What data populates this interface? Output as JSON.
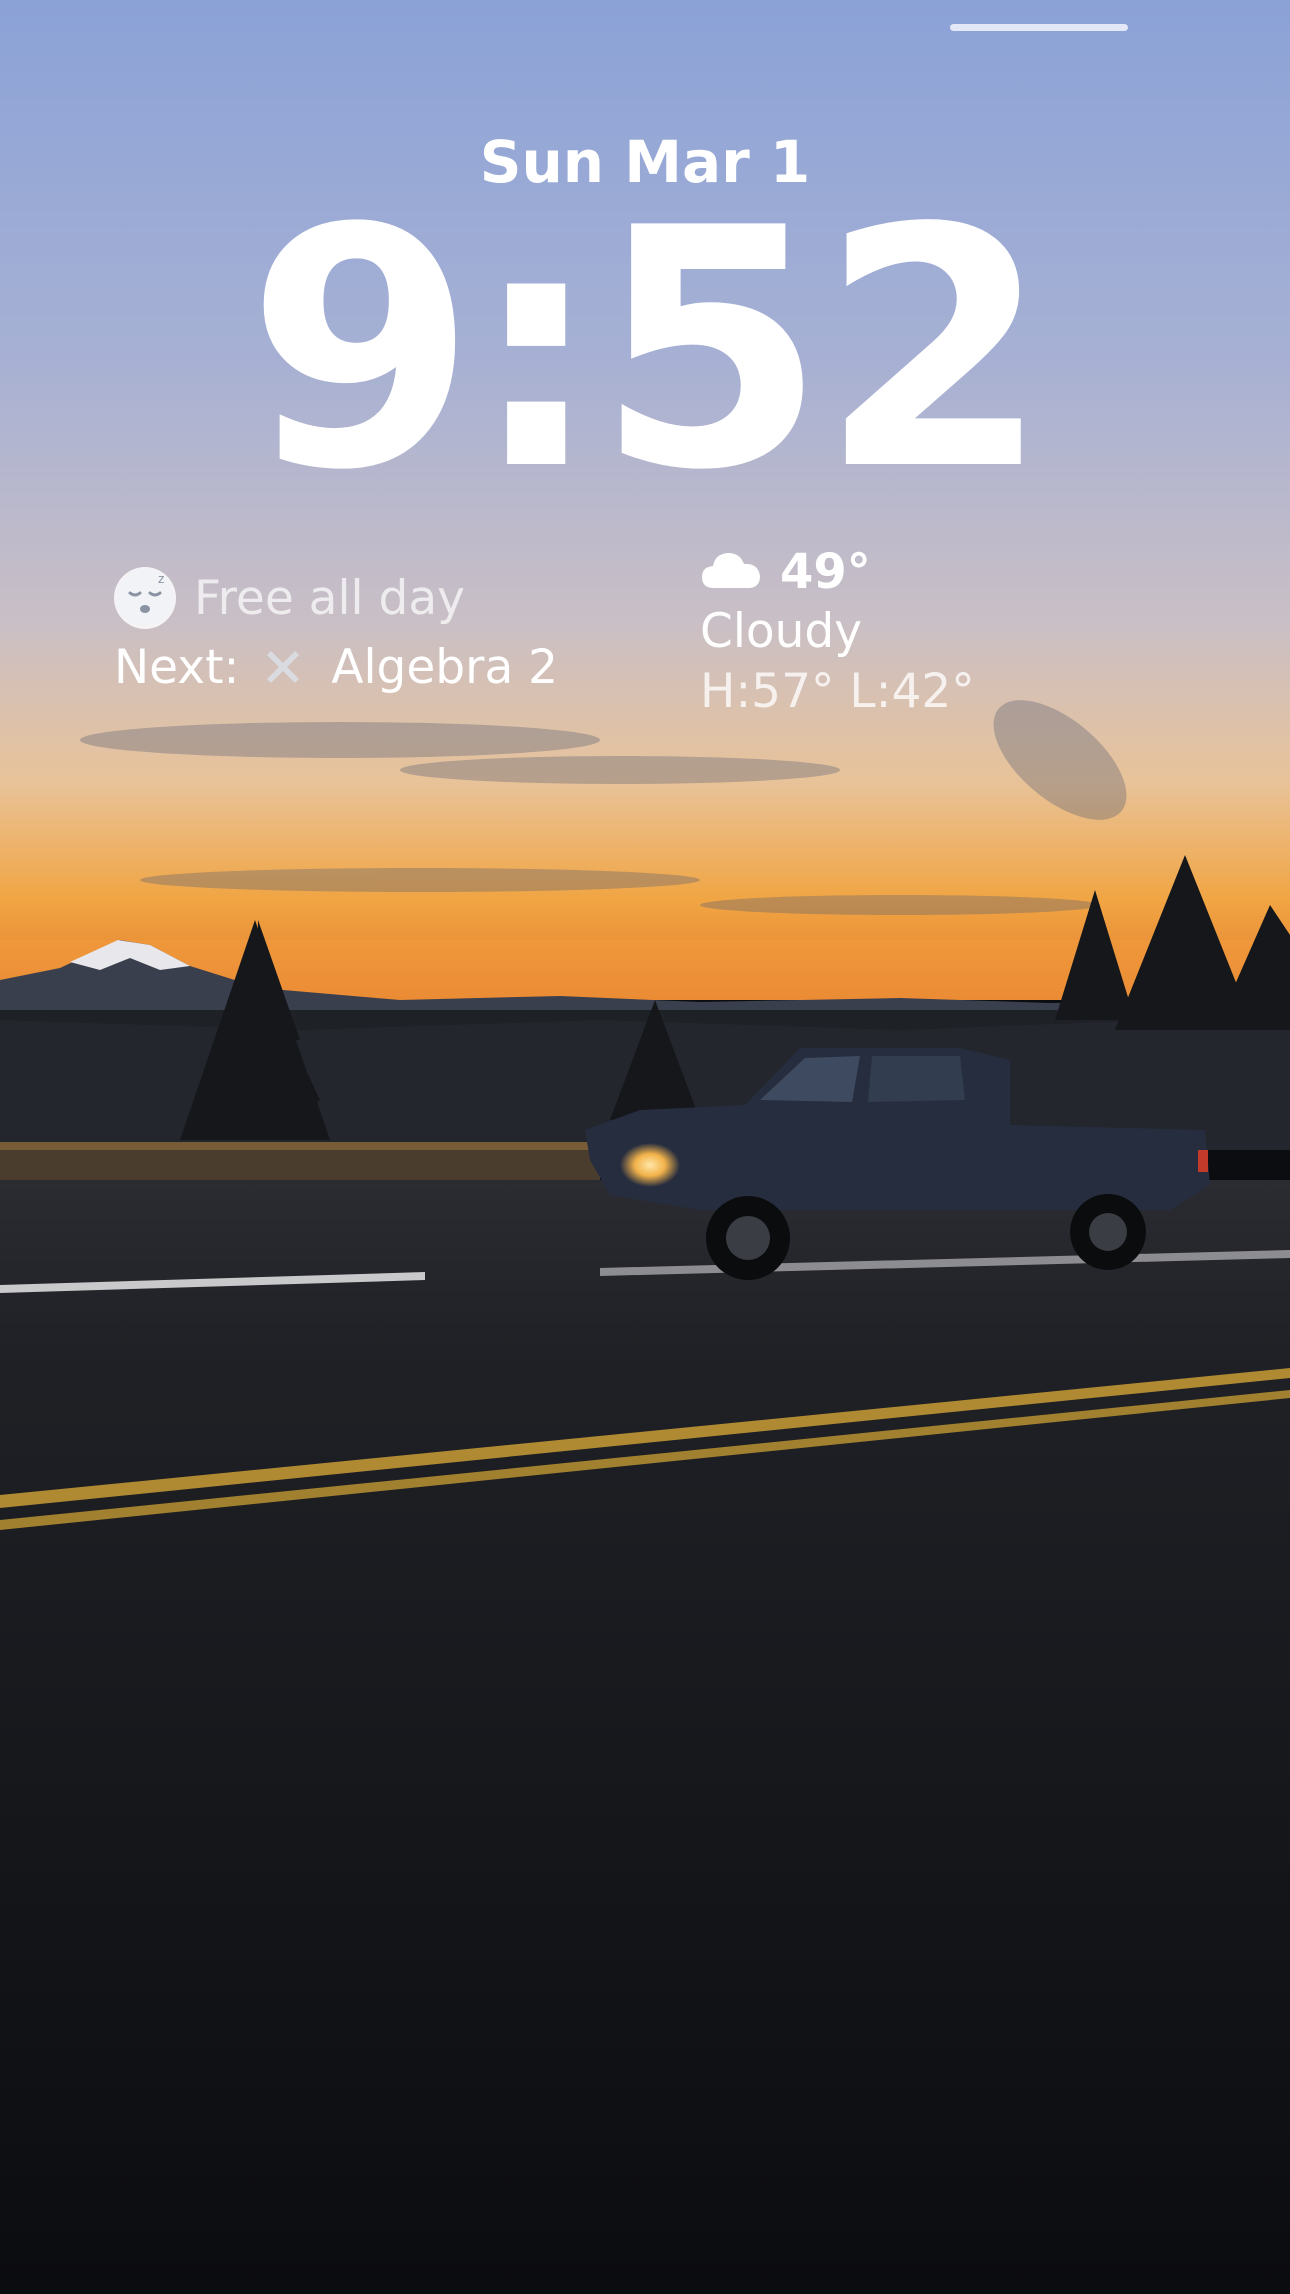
{
  "lock_screen": {
    "date": "Sun Mar 1",
    "time": "9:52"
  },
  "calendar_widget": {
    "status": "Free all day",
    "next_label": "Next:",
    "next_event": "Algebra 2",
    "avatar_icon": "sleeping-face-icon",
    "event_icon": "tools-cross-icon"
  },
  "weather_widget": {
    "icon": "cloud-icon",
    "temperature": "49°",
    "condition": "Cloudy",
    "high_low": "H:57° L:42°"
  },
  "colors": {
    "sky_top": "#8ea4d6",
    "sky_mid": "#b8b4c8",
    "horizon_glow": "#f2a33a",
    "road": "#16171b"
  }
}
